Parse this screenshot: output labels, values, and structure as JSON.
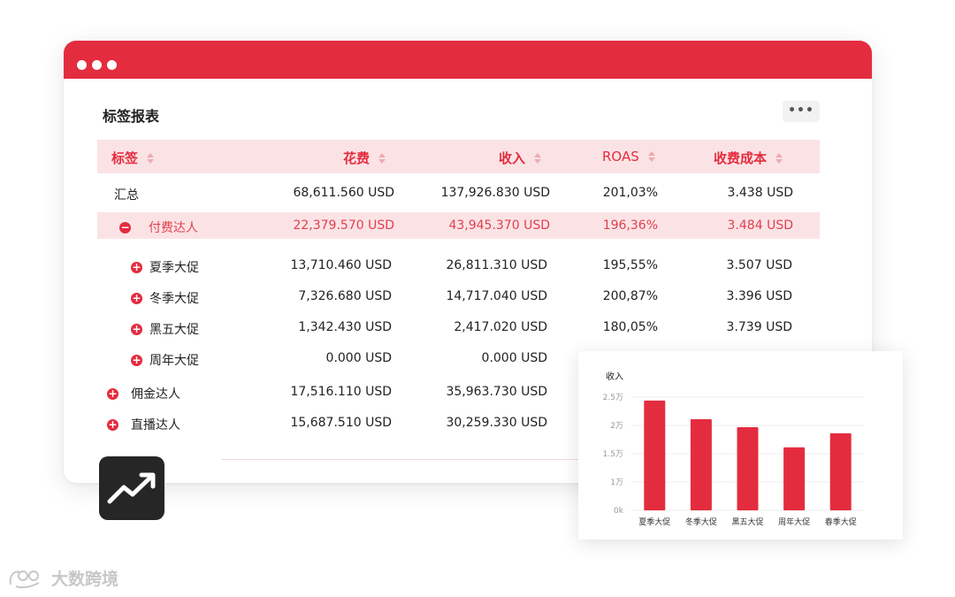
{
  "panel": {
    "title": "标签报表",
    "more_label": "•••"
  },
  "table": {
    "headers": [
      "标签",
      "花费",
      "收入",
      "ROAS",
      "收费成本"
    ],
    "rows": [
      {
        "toggle": "",
        "label": "汇总",
        "spend": "68,611.560 USD",
        "revenue": "137,926.830 USD",
        "roas": "201,03%",
        "cost": "3.438 USD"
      },
      {
        "toggle": "−",
        "label": "付费达人",
        "spend": "22,379.570 USD",
        "revenue": "43,945.370 USD",
        "roas": "196,36%",
        "cost": "3.484 USD"
      },
      {
        "toggle": "+",
        "label": "夏季大促",
        "spend": "13,710.460 USD",
        "revenue": "26,811.310 USD",
        "roas": "195,55%",
        "cost": "3.507 USD"
      },
      {
        "toggle": "+",
        "label": "冬季大促",
        "spend": "7,326.680 USD",
        "revenue": "14,717.040 USD",
        "roas": "200,87%",
        "cost": "3.396 USD"
      },
      {
        "toggle": "+",
        "label": "黑五大促",
        "spend": "1,342.430 USD",
        "revenue": "2,417.020 USD",
        "roas": "180,05%",
        "cost": "3.739 USD"
      },
      {
        "toggle": "+",
        "label": "周年大促",
        "spend": "0.000 USD",
        "revenue": "0.000 USD",
        "roas": "",
        "cost": ""
      },
      {
        "toggle": "+",
        "label": "佣金达人",
        "spend": "17,516.110 USD",
        "revenue": "35,963.730 USD",
        "roas": "",
        "cost": ""
      },
      {
        "toggle": "+",
        "label": "直播达人",
        "spend": "15,687.510 USD",
        "revenue": "30,259.330 USD",
        "roas": "",
        "cost": ""
      }
    ]
  },
  "chart_data": {
    "type": "bar",
    "title": "收入",
    "categories": [
      "夏季大促",
      "冬季大促",
      "黑五大促",
      "周年大促",
      "春季大促"
    ],
    "values": [
      23500,
      19500,
      17800,
      13500,
      16500
    ],
    "yticks": [
      "0k",
      "1万",
      "1.5万",
      "2万",
      "2.5万"
    ],
    "ytick_values": [
      0,
      5000,
      10000,
      15000,
      20000
    ],
    "ylim": [
      0,
      25000
    ],
    "color": "#e42c3f"
  },
  "icons": {
    "trend": "trending-up-icon",
    "sort": "sort-icon"
  },
  "watermark": {
    "text": "大数跨境"
  },
  "colors": {
    "accent": "#e42c3f",
    "header_bg": "#fbe3e5"
  }
}
